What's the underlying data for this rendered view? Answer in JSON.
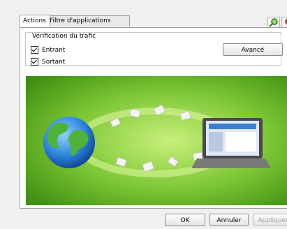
{
  "tabs": [
    {
      "label": "Actions",
      "active": true
    },
    {
      "label": "Filtre d'applications",
      "active": false
    }
  ],
  "toolbar": {
    "icons": [
      "search-icon",
      "red-icon"
    ]
  },
  "traffic": {
    "legend": "Vérification du trafic",
    "incoming_label": "Entrant",
    "incoming_checked": true,
    "outgoing_label": "Sortant",
    "outgoing_checked": true,
    "advanced_label": "Avancé"
  },
  "illustration": {
    "colors": {
      "bg": "#5fae1e",
      "highlight": "#c8f07a"
    }
  },
  "footer": {
    "ok_label": "OK",
    "cancel_label": "Annuler",
    "apply_label": "Appliquer"
  }
}
